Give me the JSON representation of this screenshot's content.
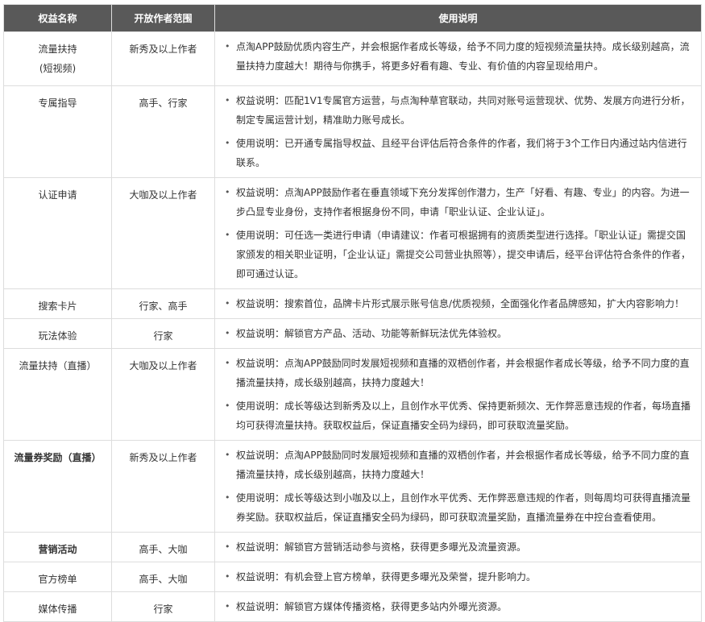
{
  "headers": [
    "权益名称",
    "开放作者范围",
    "使用说明"
  ],
  "rows": [
    {
      "name": "流量扶持",
      "name_sub": "(短视频)",
      "scope": "新秀及以上作者",
      "items": [
        "点淘APP鼓励优质内容生产，并会根据作者成长等级，给予不同力度的短视频流量扶持。成长级别越高，流量扶持力度越大！期待与你携手，将更多好看有趣、专业、有价值的内容呈现给用户。"
      ]
    },
    {
      "name": "专属指导",
      "scope": "高手、行家",
      "items": [
        "权益说明：匹配1V1专属官方运营，与点淘种草官联动，共同对账号运营现状、优势、发展方向进行分析，制定专属运营计划，精准助力账号成长。",
        "使用说明：已开通专属指导权益、且经平台评估后符合条件的作者，我们将于3个工作日内通过站内信进行联系。"
      ]
    },
    {
      "name": "认证申请",
      "scope": "大咖及以上作者",
      "items": [
        "权益说明：点淘APP鼓励作者在垂直领域下充分发挥创作潜力，生产「好看、有趣、专业」的内容。为进一步凸显专业身份，支持作者根据身份不同，申请「职业认证、企业认证」。",
        "使用说明：可任选一类进行申请（申请建议：作者可根据拥有的资质类型进行选择。「职业认证」需提交国家颁发的相关职业证明，「企业认证」需提交公司营业执照等），提交申请后，经平台评估符合条件的作者，即可通过认证。"
      ]
    },
    {
      "name": "搜索卡片",
      "scope": "行家、高手",
      "items": [
        "权益说明：搜索首位，品牌卡片形式展示账号信息/优质视频，全面强化作者品牌感知，扩大内容影响力！"
      ]
    },
    {
      "name": "玩法体验",
      "scope": "行家",
      "items": [
        "权益说明：解锁官方产品、活动、功能等新鲜玩法优先体验权。"
      ]
    },
    {
      "name": "流量扶持（直播）",
      "scope": "大咖及以上作者",
      "items": [
        "权益说明：点淘APP鼓励同时发展短视频和直播的双栖创作者，并会根据作者成长等级，给予不同力度的直播流量扶持，成长级别越高，扶持力度越大！",
        "使用说明：成长等级达到新秀及以上，且创作水平优秀、保持更新频次、无作弊恶意违规的作者，每场直播均可获得流量扶持。获取权益后，保证直播安全码为绿码，即可获取流量奖励。"
      ]
    },
    {
      "name": "流量券奖励（直播）",
      "bold": true,
      "scope": "新秀及以上作者",
      "items": [
        "权益说明：点淘APP鼓励同时发展短视频和直播的双栖创作者，并会根据作者成长等级，给予不同力度的直播流量扶持，成长级别越高，扶持力度越大！",
        "使用说明：成长等级达到小咖及以上，且创作水平优秀、无作弊恶意违规的作者，则每周均可获得直播流量券奖励。获取权益后，保证直播安全码为绿码，即可获取流量奖励，直播流量券在中控台查看使用。"
      ]
    },
    {
      "name": "营销活动",
      "bold": true,
      "scope": "高手、大咖",
      "items": [
        "权益说明：解锁官方营销活动参与资格，获得更多曝光及流量资源。"
      ]
    },
    {
      "name": "官方榜单",
      "scope": "高手、大咖",
      "items": [
        "权益说明：有机会登上官方榜单，获得更多曝光及荣誉，提升影响力。"
      ]
    },
    {
      "name": "媒体传播",
      "scope": "行家",
      "items": [
        "权益说明：解锁官方媒体传播资格，获得更多站内外曝光资源。"
      ]
    }
  ]
}
